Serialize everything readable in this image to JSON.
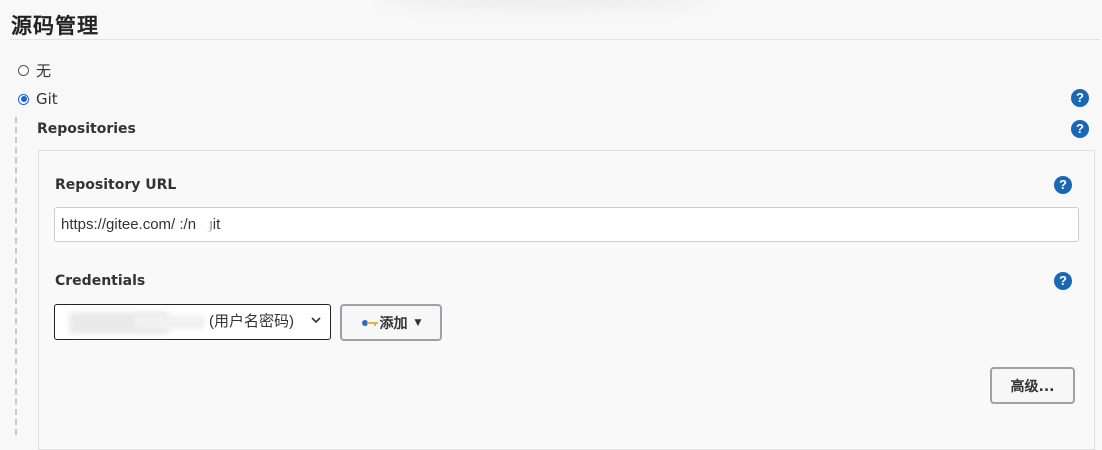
{
  "section": {
    "title": "源码管理"
  },
  "scm_options": [
    {
      "label": "无",
      "checked": false
    },
    {
      "label": "Git",
      "checked": true
    }
  ],
  "repositories": {
    "label": "Repositories",
    "repository_url": {
      "label": "Repository URL",
      "value": "https://gitee.com/   :/n                     .git"
    },
    "credentials": {
      "label": "Credentials",
      "selected_value": "(用户名密码)",
      "add_button": "添加",
      "advanced_button": "高级..."
    }
  },
  "help_icon_glyph": "?",
  "icons": [
    "radio-icon",
    "help-icon",
    "key-icon",
    "caret-down-icon",
    "chevron-down-icon"
  ],
  "colors": {
    "accent": "#1a62d6",
    "help": "#1a67b8",
    "page_bg": "#f8f8f8"
  }
}
